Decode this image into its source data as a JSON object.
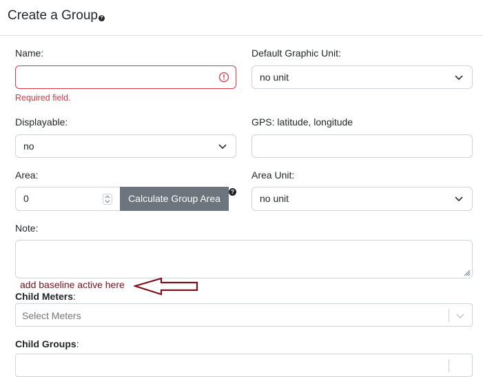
{
  "header": {
    "title": "Create a Group",
    "help_glyph": "?"
  },
  "fields": {
    "name": {
      "label": "Name:",
      "value": "",
      "error": "Required field."
    },
    "default_graphic_unit": {
      "label": "Default Graphic Unit:",
      "value": "no unit"
    },
    "displayable": {
      "label": "Displayable:",
      "value": "no"
    },
    "gps": {
      "label": "GPS: latitude, longitude",
      "value": ""
    },
    "area": {
      "label": "Area:",
      "value": "0"
    },
    "area_unit": {
      "label": "Area Unit:",
      "value": "no unit"
    },
    "note": {
      "label": "Note:",
      "value": ""
    }
  },
  "calculate_button": {
    "label": "Calculate Group Area",
    "help_glyph": "?"
  },
  "annotation": {
    "text": "add baseline active here",
    "color": "#7b0f1b"
  },
  "child_meters": {
    "label": "Child Meters",
    "suffix": ":",
    "placeholder": "Select Meters"
  },
  "child_groups": {
    "label": "Child Groups",
    "suffix": ":"
  },
  "colors": {
    "error": "#dc3545",
    "button": "#6c757d",
    "border": "#ced4da"
  },
  "icons": [
    "help-icon",
    "error-icon",
    "chevron-down-icon",
    "spinner-icon",
    "resize-handle-icon",
    "arrow-icon"
  ]
}
